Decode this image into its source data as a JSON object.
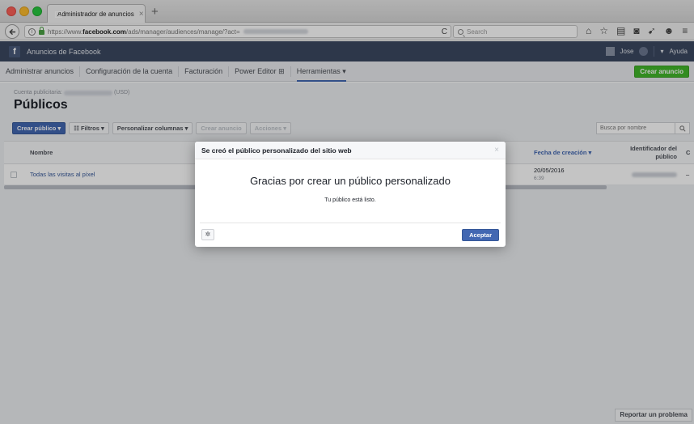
{
  "browser": {
    "tab_title": "Administrador de anuncios",
    "tab_close": "×",
    "new_tab": "+",
    "url_prefix": "https://www.",
    "url_domain": "facebook.com",
    "url_path": "/ads/manager/audiences/manage/?act=",
    "search_placeholder": "Search",
    "reload": "C"
  },
  "fb_header": {
    "logo": "f",
    "title": "Anuncios de Facebook",
    "user": "Jose",
    "help": "Ayuda"
  },
  "subnav": {
    "items": [
      "Administrar anuncios",
      "Configuración de la cuenta",
      "Facturación",
      "Power Editor ⊞",
      "Herramientas ▾"
    ],
    "create_ad": "Crear anuncio"
  },
  "page": {
    "account_label": "Cuenta publicitaria:",
    "account_currency": "(USD)",
    "title": "Públicos",
    "actions": {
      "create_audience": "Crear público ▾",
      "filters": "☷ Filtros ▾",
      "customize_columns": "Personalizar columnas ▾",
      "create_ad": "Crear anuncio",
      "actions": "Acciones ▾"
    },
    "search_placeholder": "Busca por nombre",
    "report_problem": "Reportar un problema"
  },
  "table": {
    "headers": {
      "name": "Nombre",
      "date": "Fecha de creación ▾",
      "id_line1": "Identificador del",
      "id_line2": "público",
      "extra": "C"
    },
    "rows": [
      {
        "name": "Todas las visitas al píxel",
        "date": "20/05/2016",
        "time": "6:39",
        "extra": "–"
      }
    ]
  },
  "modal": {
    "title": "Se creó el público personalizado del sitio web",
    "close": "×",
    "heading": "Gracias por crear un público personalizado",
    "subtext": "Tu público está listo.",
    "gear": "✲",
    "accept": "Aceptar"
  }
}
